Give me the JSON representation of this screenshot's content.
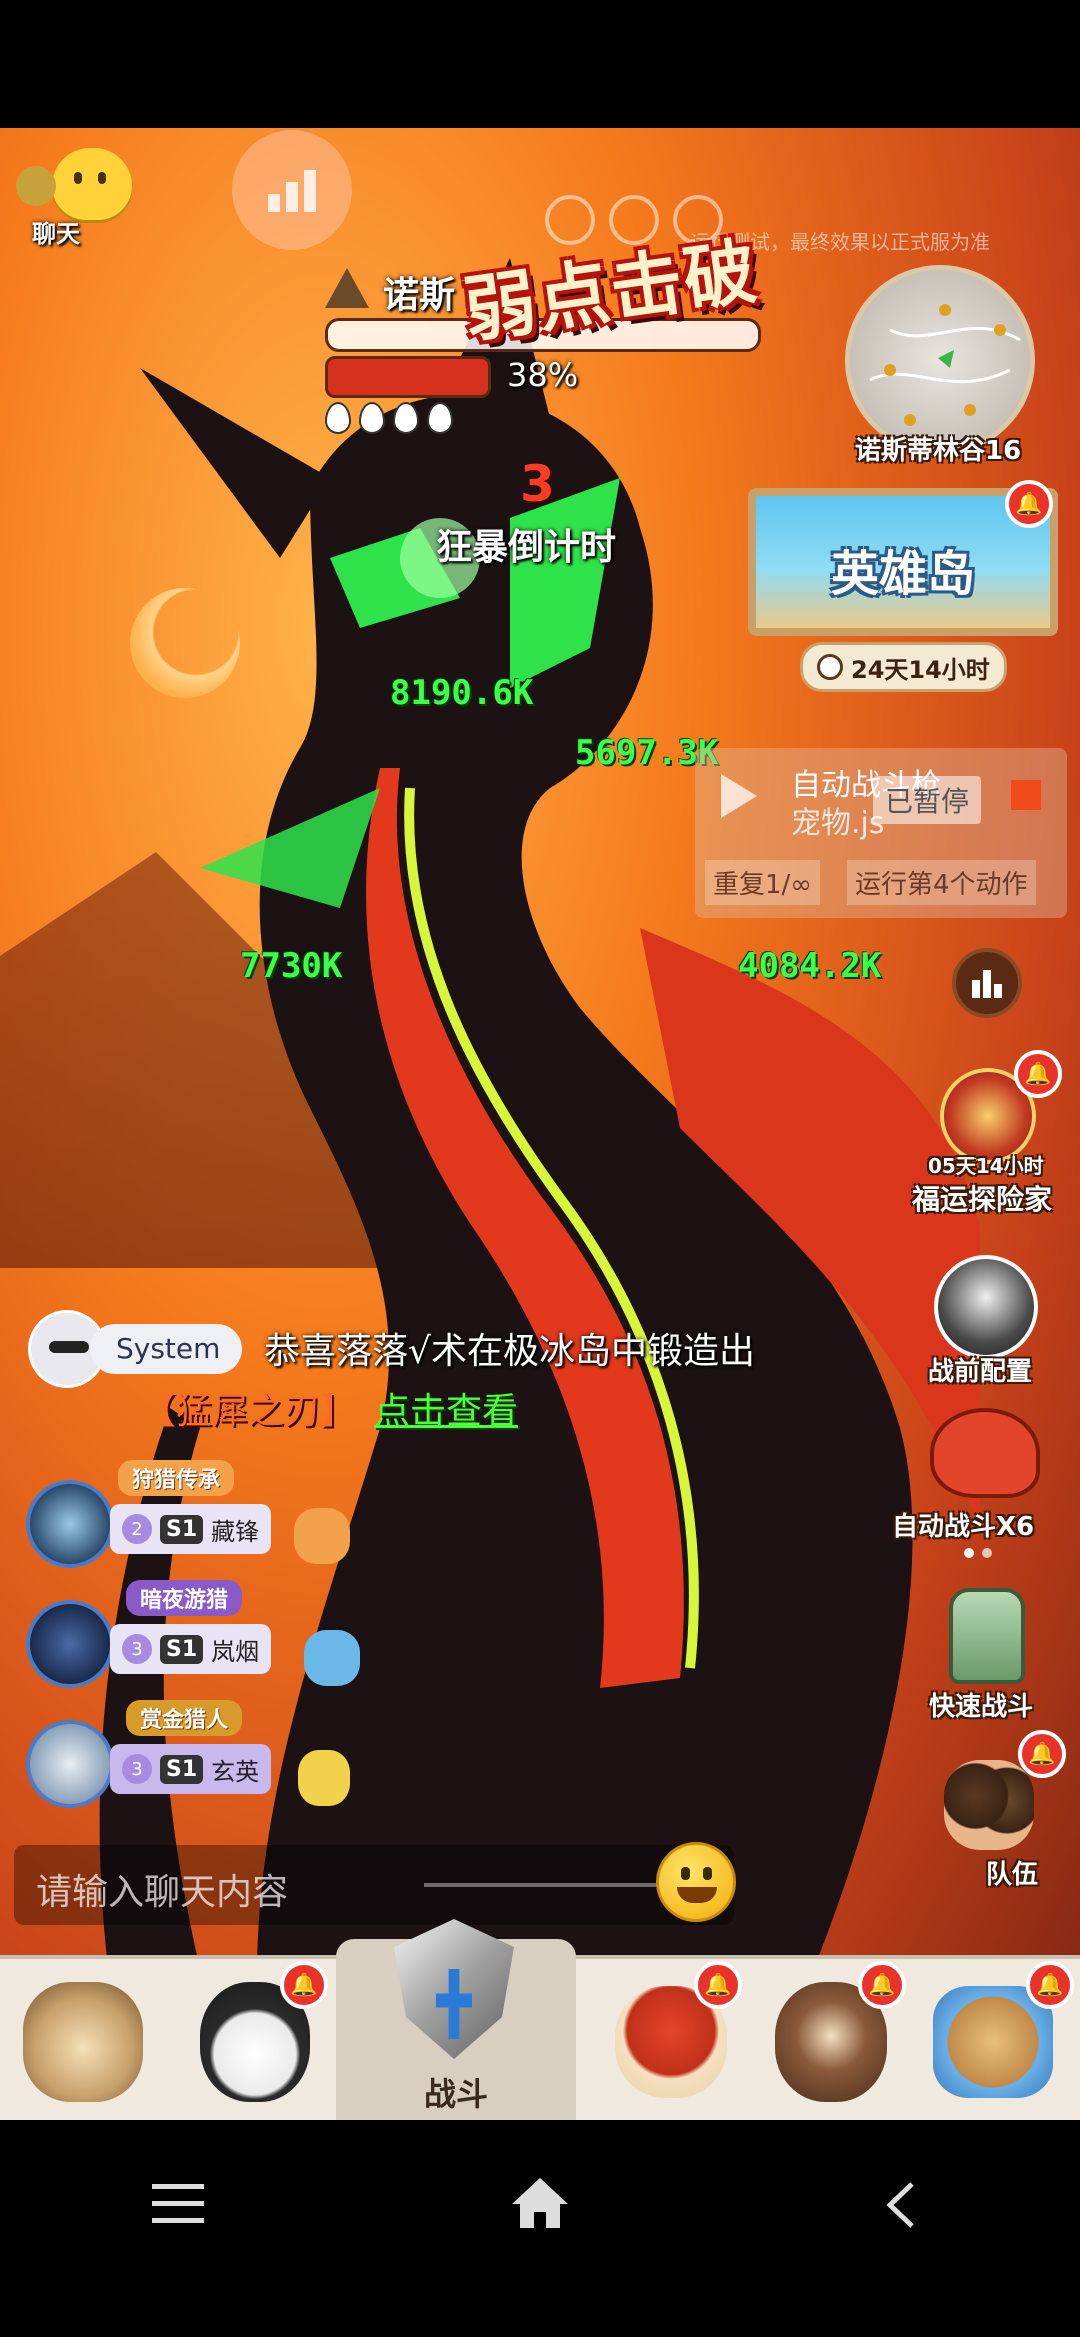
{
  "chat_button": {
    "label": "聊天"
  },
  "boss": {
    "name": "诺斯",
    "hp_percent_text": "38%",
    "hp_fraction": 0.38,
    "lives": 4,
    "weakness_banner": "弱点击破",
    "rage_countdown_number": "3",
    "rage_countdown_label": "狂暴倒计时"
  },
  "top_notice": "运行测试，最终效果以正式服为准",
  "minimap": {
    "label": "诺斯蒂林谷16"
  },
  "hero_island": {
    "title": "英雄岛",
    "timer": "24天14小时"
  },
  "damage_numbers": [
    "8190.6K",
    "5697.3K",
    "7730K",
    "4084.2K"
  ],
  "auto_script": {
    "line1": "自动战斗枪",
    "line2": "宠物.js",
    "status": "已暂停",
    "repeat": "重复1/∞",
    "step": "运行第4个动作"
  },
  "side_menu": {
    "fortune_timer": "05天14小时",
    "fortune_label": "福运探险家",
    "prebattle_label": "战前配置",
    "auto_battle_label": "自动战斗X6",
    "quick_battle_label": "快速战斗",
    "team_label": "队伍"
  },
  "system_message": {
    "sender": "System",
    "text": "恭喜落落√术在极冰岛中锻造出",
    "item": "【猛犀之刃】",
    "link": "点击查看"
  },
  "players": [
    {
      "title": "狩猎传承",
      "level": "2",
      "season": "S1",
      "name": "藏锋"
    },
    {
      "title": "暗夜游猎",
      "level": "3",
      "season": "S1",
      "name": "岚烟"
    },
    {
      "title": "赏金猎人",
      "level": "3",
      "season": "S1",
      "name": "玄英"
    }
  ],
  "chat_input": {
    "placeholder": "请输入聊天内容"
  },
  "tabbar": {
    "battle_label": "战斗"
  },
  "colors": {
    "accent_red": "#e8322a",
    "damage_green": "#3cff4a",
    "sky_orange": "#f57a1c"
  }
}
